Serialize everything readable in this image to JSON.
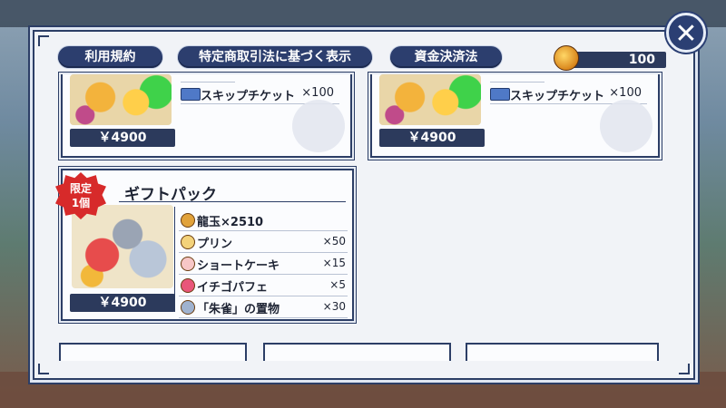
{
  "header": {
    "buttons": {
      "terms": "利用規約",
      "commerce_law": "特定商取引法に基づく表示",
      "fund_settlement": "資金決済法"
    },
    "currency_amount": "100"
  },
  "close_icon": "close-icon",
  "cards": [
    {
      "items": [
        {
          "name": "スキップチケット",
          "qty": "×100"
        }
      ],
      "price": "￥4900"
    },
    {
      "items": [
        {
          "name": "スキップチケット",
          "qty": "×100"
        }
      ],
      "price": "￥4900"
    }
  ],
  "gift_pack": {
    "badge": "限定\n1個",
    "badge_line1": "限定",
    "badge_line2": "1個",
    "title": "ギフトパック",
    "price": "￥4900",
    "items": [
      {
        "name": "龍玉×2510",
        "qty": ""
      },
      {
        "name": "プリン",
        "qty": "×50"
      },
      {
        "name": "ショートケーキ",
        "qty": "×15"
      },
      {
        "name": "イチゴパフェ",
        "qty": "×5"
      },
      {
        "name": "「朱雀」の置物",
        "qty": "×30"
      }
    ]
  },
  "colors": {
    "accent": "#2c3e6e",
    "panel": "#f1f3f7",
    "badge": "#d72a2a"
  }
}
